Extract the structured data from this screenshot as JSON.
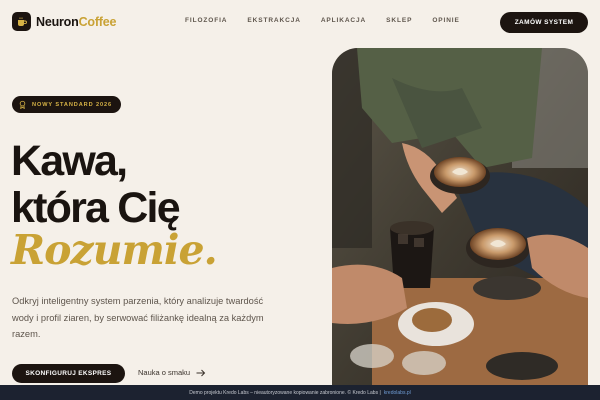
{
  "brand": {
    "name_part1": "Neuron",
    "name_part2": "Coffee",
    "accent_color": "#c9a235",
    "dark_color": "#1c1410"
  },
  "nav": {
    "items": [
      "FILOZOFIA",
      "EKSTRAKCJA",
      "APLIKACJA",
      "SKLEP",
      "OPINIE"
    ],
    "cta_label": "ZAMÓW SYSTEM"
  },
  "hero": {
    "badge": "NOWY STANDARD 2026",
    "title_line1": "Kawa,",
    "title_line2": "która Cię",
    "title_accent": "Rozumie.",
    "description": "Odkryj inteligentny system parzenia, który analizuje twardość wody i profil ziaren, by serwować filiżankę idealną za każdym razem.",
    "primary_button": "SKONFIGURUJ EKSPRES",
    "secondary_link": "Nauka o smaku",
    "image_icon": "coffee-cups-photo"
  },
  "footer": {
    "text": "Demo projektu Kredo Labs – nieautoryzowane kopiowanie zabronione. © Kredo Labs |",
    "link": "kredolabs.pl"
  }
}
